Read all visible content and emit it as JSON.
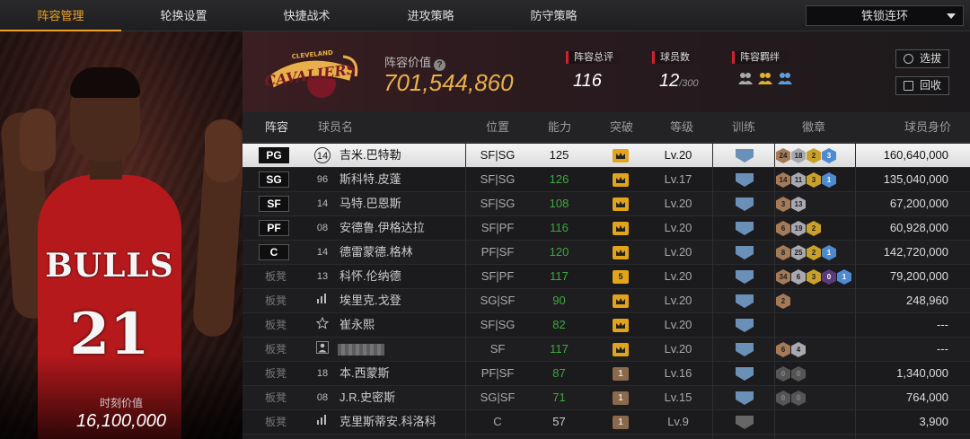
{
  "nav": {
    "tabs": [
      {
        "label": "阵容管理",
        "active": true
      },
      {
        "label": "轮换设置",
        "active": false
      },
      {
        "label": "快捷战术",
        "active": false
      },
      {
        "label": "进攻策略",
        "active": false
      },
      {
        "label": "防守策略",
        "active": false
      }
    ],
    "dropdown_value": "铁锁连环"
  },
  "player_card": {
    "jersey_text": "BULLS",
    "jersey_number": "21",
    "value_label": "时刻价值",
    "value": "16,100,000"
  },
  "team": {
    "logo_text": "CAVALIERS",
    "logo_top_text": "CLEVELAND",
    "value_label": "阵容价值",
    "help_icon": "?",
    "value": "701,544,860",
    "rating_label": "阵容总评",
    "rating": "116",
    "count_label": "球员数",
    "count": "12",
    "count_max": "/300",
    "bond_label": "阵容羁绊",
    "buttons": {
      "select": "选拔",
      "recycle": "回收"
    }
  },
  "columns": [
    "阵容",
    "球员名",
    "位置",
    "能力",
    "突破",
    "等级",
    "训练",
    "徽章",
    "球员身价"
  ],
  "rows": [
    {
      "slot": "PG",
      "starter": true,
      "selected": true,
      "num": "14",
      "num_circle": true,
      "name": "吉米.巴特勒",
      "pos": "SF|SG",
      "ovr": "125",
      "green": false,
      "brk": "crown",
      "lvl": "Lv.20",
      "train": "blue",
      "badges": [
        [
          "b",
          "24"
        ],
        [
          "s",
          "18"
        ],
        [
          "g",
          "2"
        ],
        [
          "bl",
          "3"
        ]
      ],
      "salary": "160,640,000"
    },
    {
      "slot": "SG",
      "starter": true,
      "num": "96",
      "name": "斯科特.皮蓬",
      "pos": "SF|SG",
      "ovr": "126",
      "green": true,
      "brk": "crown",
      "lvl": "Lv.17",
      "train": "blue",
      "badges": [
        [
          "b",
          "14"
        ],
        [
          "s",
          "11"
        ],
        [
          "g",
          "3"
        ],
        [
          "bl",
          "1"
        ]
      ],
      "salary": "135,040,000"
    },
    {
      "slot": "SF",
      "starter": true,
      "num": "14",
      "name": "马特.巴恩斯",
      "pos": "SF|SG",
      "ovr": "108",
      "green": true,
      "brk": "crown",
      "lvl": "Lv.20",
      "train": "blue",
      "badges": [
        [
          "b",
          "3"
        ],
        [
          "s",
          "13"
        ]
      ],
      "salary": "67,200,000"
    },
    {
      "slot": "PF",
      "starter": true,
      "num": "08",
      "name": "安德鲁.伊格达拉",
      "pos": "SF|PF",
      "ovr": "116",
      "green": true,
      "brk": "crown",
      "lvl": "Lv.20",
      "train": "blue",
      "badges": [
        [
          "b",
          "6"
        ],
        [
          "s",
          "19"
        ],
        [
          "g",
          "2"
        ]
      ],
      "salary": "60,928,000"
    },
    {
      "slot": "C",
      "starter": true,
      "num": "14",
      "name": "德雷蒙德.格林",
      "pos": "PF|SF",
      "ovr": "120",
      "green": true,
      "brk": "crown",
      "lvl": "Lv.20",
      "train": "blue",
      "badges": [
        [
          "b",
          "8"
        ],
        [
          "s",
          "25"
        ],
        [
          "g",
          "2"
        ],
        [
          "bl",
          "1"
        ]
      ],
      "salary": "142,720,000"
    },
    {
      "slot": "板凳",
      "starter": false,
      "num": "13",
      "name": "科怀.伦纳德",
      "pos": "SF|PF",
      "ovr": "117",
      "green": true,
      "brk": "5",
      "lvl": "Lv.20",
      "train": "blue",
      "badges": [
        [
          "b",
          "34"
        ],
        [
          "s",
          "6"
        ],
        [
          "g",
          "3"
        ],
        [
          "p",
          "0"
        ],
        [
          "bl",
          "1"
        ]
      ],
      "salary": "79,200,000"
    },
    {
      "slot": "板凳",
      "starter": false,
      "num": "bars",
      "name": "埃里克.戈登",
      "pos": "SG|SF",
      "ovr": "90",
      "green": true,
      "brk": "crown",
      "lvl": "Lv.20",
      "train": "blue",
      "badges": [
        [
          "b",
          "2"
        ]
      ],
      "salary": "248,960"
    },
    {
      "slot": "板凳",
      "starter": false,
      "num": "star",
      "name": "崔永熙",
      "pos": "SF|SG",
      "ovr": "82",
      "green": true,
      "brk": "crown",
      "lvl": "Lv.20",
      "train": "blue",
      "badges": [],
      "salary": "---"
    },
    {
      "slot": "板凳",
      "starter": false,
      "num": "person",
      "name": "",
      "blurred": true,
      "pos": "SF",
      "ovr": "117",
      "green": true,
      "brk": "crown",
      "lvl": "Lv.20",
      "train": "blue",
      "badges": [
        [
          "b",
          "6"
        ],
        [
          "s",
          "4"
        ]
      ],
      "salary": "---"
    },
    {
      "slot": "板凳",
      "starter": false,
      "num": "18",
      "name": "本.西蒙斯",
      "pos": "PF|SF",
      "ovr": "87",
      "green": true,
      "brk": "1",
      "lvl": "Lv.16",
      "train": "blue",
      "badges": [
        [
          "d",
          "0"
        ],
        [
          "d",
          "0"
        ]
      ],
      "salary": "1,340,000"
    },
    {
      "slot": "板凳",
      "starter": false,
      "num": "08",
      "name": "J.R.史密斯",
      "pos": "SG|SF",
      "ovr": "71",
      "green": true,
      "brk": "1",
      "lvl": "Lv.15",
      "train": "blue",
      "badges": [
        [
          "d",
          "0"
        ],
        [
          "d",
          "0"
        ]
      ],
      "salary": "764,000"
    },
    {
      "slot": "板凳",
      "starter": false,
      "num": "bars",
      "name": "克里斯蒂安.科洛科",
      "pos": "C",
      "ovr": "57",
      "green": false,
      "brk": "1",
      "lvl": "Lv.9",
      "train": "gray",
      "badges": [],
      "salary": "3,900"
    }
  ]
}
